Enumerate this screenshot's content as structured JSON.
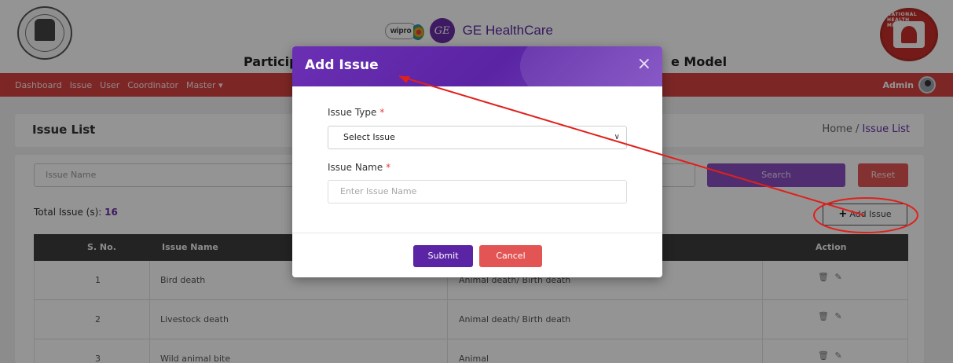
{
  "header": {
    "brand_wipro": "wipro",
    "brand_ge": "GE HealthCare",
    "ge_mark": "GE",
    "title_left": "Particip",
    "title_right": "e Model",
    "left_logo_icon": "state-emblem-logo",
    "right_logo_icon": "national-health-mission-logo",
    "right_logo_arc": "NATIONAL HEALTH MISSION"
  },
  "nav": {
    "items": [
      "Dashboard",
      "Issue",
      "User",
      "Coordinator",
      "Master ▾"
    ],
    "admin_label": "Admin"
  },
  "page": {
    "title": "Issue List",
    "breadcrumb_home": "Home",
    "breadcrumb_sep": "/",
    "breadcrumb_current": "Issue List"
  },
  "filters": {
    "search_placeholder": "Issue Name",
    "search_button": "Search",
    "reset_button": "Reset"
  },
  "list": {
    "total_label": "Total Issue (s):",
    "total_count": "16",
    "add_button_icon": "+",
    "add_button_label": "Add Issue"
  },
  "table": {
    "headers": [
      "S. No.",
      "Issue Name",
      "",
      "Action"
    ],
    "rows": [
      {
        "sno": "1",
        "name": "Bird death",
        "type": "Animal death/ Birth death"
      },
      {
        "sno": "2",
        "name": "Livestock death",
        "type": "Animal death/ Birth death"
      },
      {
        "sno": "3",
        "name": "Wild animal bite",
        "type": "Animal"
      }
    ],
    "action_icons": [
      "trash-icon",
      "pencil-icon"
    ]
  },
  "modal": {
    "title": "Add Issue",
    "close": "×",
    "issue_type_label": "Issue Type",
    "issue_type_value": "Select Issue",
    "issue_name_label": "Issue Name",
    "issue_name_placeholder": "Enter Issue Name",
    "required_mark": "*",
    "submit": "Submit",
    "cancel": "Cancel"
  },
  "colors": {
    "primary": "#5a24a4",
    "navbar": "#d84343",
    "danger": "#e35555",
    "annotation": "#e0201b"
  }
}
